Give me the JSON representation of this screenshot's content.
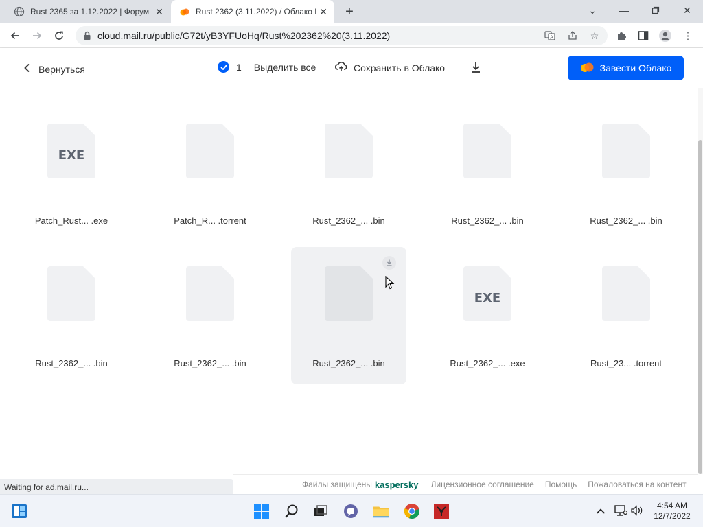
{
  "browser": {
    "tabs": [
      {
        "title": "Rust 2365 за 1.12.2022 | Форум (",
        "active": false
      },
      {
        "title": "Rust 2362 (3.11.2022) / Облако М",
        "active": true
      }
    ],
    "new_tab_symbol": "+",
    "url": "cloud.mail.ru/public/G72t/yB3YFUoHq/Rust%202362%20(3.11.2022)"
  },
  "header": {
    "back_label": "Вернуться",
    "selected_count": "1",
    "select_all_label": "Выделить все",
    "save_to_cloud_label": "Сохранить в Облако",
    "cta_label": "Завести Облако",
    "accent_color": "#005ff9"
  },
  "files": [
    {
      "name": "Patch_Rust... .exe",
      "icon": "exe-file-icon",
      "badge": "EXE"
    },
    {
      "name": "Patch_R... .torrent",
      "icon": "file-icon",
      "badge": ""
    },
    {
      "name": "Rust_2362_... .bin",
      "icon": "file-icon",
      "badge": ""
    },
    {
      "name": "Rust_2362_... .bin",
      "icon": "file-icon",
      "badge": ""
    },
    {
      "name": "Rust_2362_... .bin",
      "icon": "file-icon",
      "badge": ""
    },
    {
      "name": "Rust_2362_... .bin",
      "icon": "file-icon",
      "badge": ""
    },
    {
      "name": "Rust_2362_... .bin",
      "icon": "file-icon",
      "badge": ""
    },
    {
      "name": "Rust_2362_... .bin",
      "icon": "file-icon",
      "badge": "",
      "hovered": true
    },
    {
      "name": "Rust_2362_... .exe",
      "icon": "exe-file-icon",
      "badge": "EXE"
    },
    {
      "name": "Rust_23... .torrent",
      "icon": "file-icon",
      "badge": ""
    }
  ],
  "status_text": "Waiting for ad.mail.ru...",
  "footer": {
    "protected_label": "Файлы защищены",
    "kaspersky_label": "kaspersky",
    "license_label": "Лицензионное соглашение",
    "help_label": "Помощь",
    "report_label": "Пожаловаться на контент"
  },
  "taskbar": {
    "time": "4:54 AM",
    "date": "12/7/2022"
  }
}
